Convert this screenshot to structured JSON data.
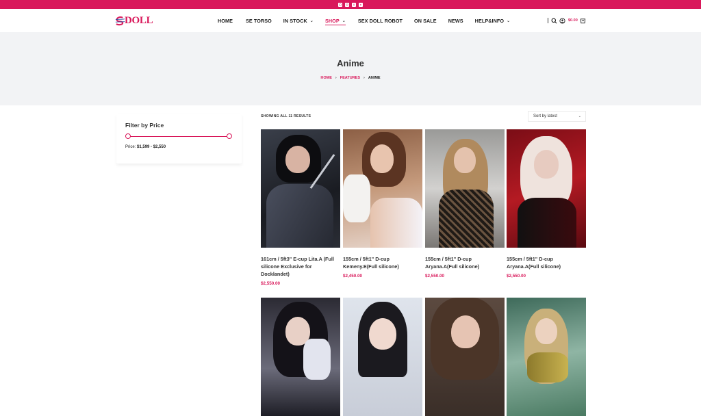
{
  "header": {
    "logo_text": "DOLL",
    "nav": [
      {
        "label": "HOME",
        "has_dropdown": false,
        "active": false
      },
      {
        "label": "SE TORSO",
        "has_dropdown": false,
        "active": false
      },
      {
        "label": "IN STOCK",
        "has_dropdown": true,
        "active": false
      },
      {
        "label": "SHOP",
        "has_dropdown": true,
        "active": true
      },
      {
        "label": "SEX DOLL ROBOT",
        "has_dropdown": false,
        "active": false
      },
      {
        "label": "ON SALE",
        "has_dropdown": false,
        "active": false
      },
      {
        "label": "NEWS",
        "has_dropdown": false,
        "active": false
      },
      {
        "label": "HELP&INFO",
        "has_dropdown": true,
        "active": false
      }
    ],
    "cart_total": "$0.00"
  },
  "hero": {
    "title": "Anime",
    "breadcrumb": {
      "home": "HOME",
      "parent": "FEATURES",
      "current": "ANIME"
    }
  },
  "filter": {
    "title": "Filter by Price",
    "price_prefix": "Price:",
    "price_range": "$1,599 - $2,550"
  },
  "results": {
    "showing": "SHOWING ALL 11 RESULTS",
    "sort_selected": "Sort by latest"
  },
  "products": [
    {
      "title": "161cm / 5ft3\" E-cup Lita.A (Full silicone Exclusive for Docklandet)",
      "price": "$2,550.00"
    },
    {
      "title": "155cm / 5ft1\" D-cup Kemeny.E(Full silicone)",
      "price": "$2,450.00"
    },
    {
      "title": "155cm / 5ft1\" D-cup Aryana.A(Full silicone)",
      "price": "$2,550.00"
    },
    {
      "title": "155cm / 5ft1\" D-cup Aryana.A(Full silicone)",
      "price": "$2,550.00"
    },
    {
      "title": "",
      "price": ""
    },
    {
      "title": "",
      "price": ""
    },
    {
      "title": "",
      "price": ""
    },
    {
      "title": "",
      "price": ""
    }
  ],
  "colors": {
    "brand": "#d9195b",
    "hero_bg": "#f2f3f5",
    "text": "#1c1c1c"
  },
  "icons": {
    "social": [
      "instagram-icon",
      "pinterest-icon",
      "facebook-icon",
      "youtube-icon"
    ],
    "header": [
      "search-icon",
      "account-icon",
      "cart-icon"
    ]
  }
}
